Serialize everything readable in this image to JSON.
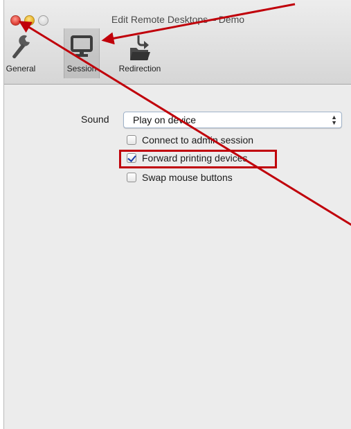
{
  "window": {
    "title": "Edit Remote Desktops – Demo"
  },
  "toolbar": {
    "items": [
      {
        "label": "General",
        "icon": "wrench-icon"
      },
      {
        "label": "Session",
        "icon": "monitor-icon",
        "selected": true
      },
      {
        "label": "Redirection",
        "icon": "folder-redirect-icon"
      }
    ]
  },
  "session": {
    "sound_label": "Sound",
    "sound_value": "Play on device",
    "options": [
      {
        "label": "Connect to admin session",
        "checked": false
      },
      {
        "label": "Forward printing devices",
        "checked": true
      },
      {
        "label": "Swap mouse buttons",
        "checked": false
      }
    ]
  },
  "colors": {
    "annotation": "#c0000a",
    "window_bg": "#ececec"
  }
}
